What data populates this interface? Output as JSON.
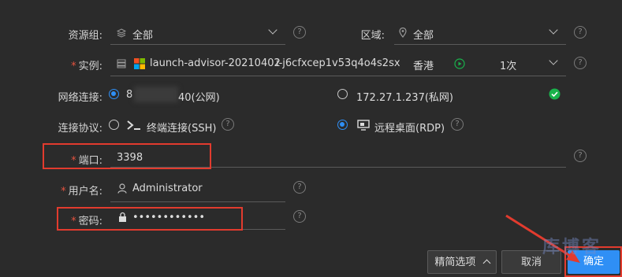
{
  "form": {
    "resource_group": {
      "label": "资源组:",
      "value": "全部"
    },
    "region": {
      "label": "区域:",
      "value": "全部"
    },
    "instance": {
      "label": "实例:",
      "name": "launch-advisor-20210402",
      "id": "i-j6cfxcep1v53q4o4s2sx",
      "location": "香港",
      "count": "1次"
    },
    "network": {
      "label": "网络连接:",
      "public_prefix": "8",
      "public_suffix": "40(公网)",
      "private": "172.27.1.237(私网)"
    },
    "protocol": {
      "label": "连接协议:",
      "ssh": "终端连接(SSH)",
      "rdp": "远程桌面(RDP)"
    },
    "port": {
      "label": "端口:",
      "value": "3398"
    },
    "username": {
      "label": "用户名:",
      "value": "Administrator"
    },
    "password": {
      "label": "密码:",
      "value": "••••••••••••"
    }
  },
  "buttons": {
    "advanced": "精简选项",
    "cancel": "取消",
    "confirm": "确定"
  },
  "watermark": "库博客",
  "colors": {
    "accent": "#2f8ff5",
    "success": "#19b24b",
    "annotation": "#e23b2e"
  }
}
